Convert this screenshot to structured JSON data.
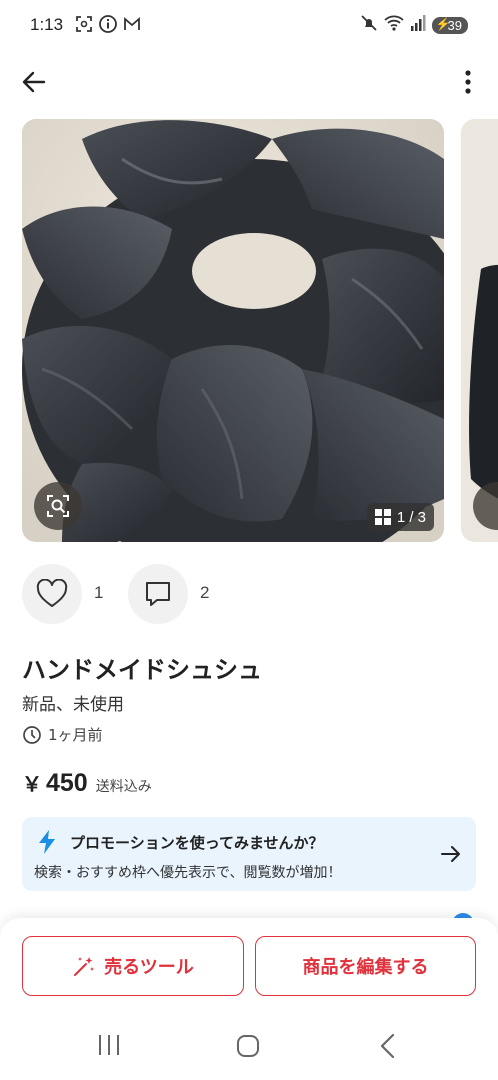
{
  "status_bar": {
    "time": "1:13",
    "battery": "39",
    "left_icons": [
      "screenshot-icon",
      "info-icon",
      "gmail-icon"
    ],
    "right_icons": [
      "mute-icon",
      "wifi-icon",
      "signal-icon"
    ]
  },
  "app_bar": {
    "back_icon": "back-arrow-icon",
    "menu_icon": "more-vert-icon"
  },
  "gallery": {
    "counter": "1 / 3",
    "lens_icon": "image-search-icon"
  },
  "actions": {
    "like_count": "1",
    "comment_count": "2"
  },
  "product": {
    "title": "ハンドメイドシュシュ",
    "condition": "新品、未使用",
    "posted": "1ヶ月前",
    "price_symbol": "￥",
    "price": "450",
    "shipping": "送料込み"
  },
  "promo": {
    "title": "プロモーションを使ってみませんか？",
    "subtitle": "検索・おすすめ枠へ優先表示で、閲覧数が増加！"
  },
  "bottom_actions": {
    "sell_tools": "売るツール",
    "edit_item": "商品を編集する"
  },
  "colors": {
    "accent_red": "#e0323c",
    "promo_bg": "#e9f4fd",
    "promo_icon": "#1a8fe3"
  }
}
